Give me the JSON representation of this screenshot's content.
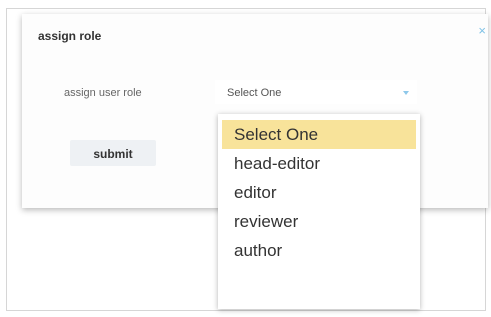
{
  "modal": {
    "title": "assign role",
    "close_glyph": "×"
  },
  "form": {
    "label": "assign user role",
    "select_value": "Select One",
    "submit_label": "submit"
  },
  "dropdown": {
    "options": [
      {
        "label": "Select One",
        "selected": true
      },
      {
        "label": "head-editor",
        "selected": false
      },
      {
        "label": "editor",
        "selected": false
      },
      {
        "label": "reviewer",
        "selected": false
      },
      {
        "label": "author",
        "selected": false
      }
    ]
  },
  "colors": {
    "accent": "#8ec8ea",
    "highlight": "#f8e39a"
  }
}
